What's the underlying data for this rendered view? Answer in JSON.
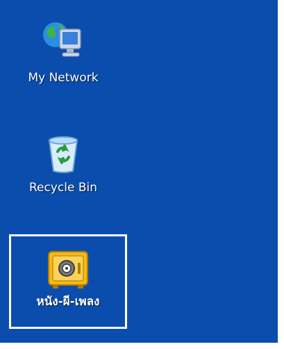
{
  "desktop": {
    "background": "#0b4dad",
    "icons": [
      {
        "label": "My Network",
        "icon": "network-computer-icon",
        "selected": false
      },
      {
        "label": "Recycle Bin",
        "icon": "recycle-bin-icon",
        "selected": false
      },
      {
        "label": "หนัง-ผี-เพลง",
        "icon": "safe-icon",
        "selected": true
      }
    ]
  }
}
